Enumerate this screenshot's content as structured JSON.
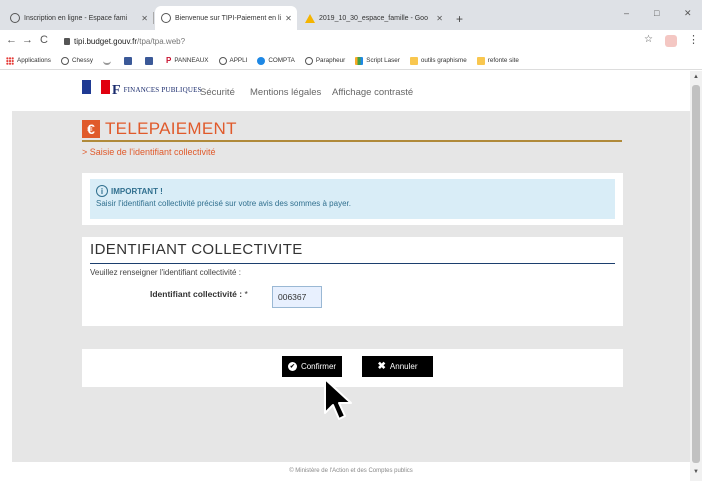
{
  "browser": {
    "tabs": [
      {
        "label": "Inscription en ligne - Espace fami"
      },
      {
        "label": "Bienvenue sur TIPI-Paiement en li"
      },
      {
        "label": "2019_10_30_espace_famille - Goo"
      }
    ],
    "new_tab": "+",
    "window_controls": {
      "minimize": "–",
      "maximize": "□",
      "close": "✕"
    },
    "nav": {
      "back": "←",
      "forward": "→",
      "reload": "C"
    },
    "url_domain": "tipi.budget.gouv.fr",
    "url_path": "/tpa/tpa.web?",
    "star": "☆",
    "menu": "⋮",
    "bookmarks": [
      {
        "label": "Applications"
      },
      {
        "label": "Chessy"
      },
      {
        "label": ""
      },
      {
        "label": ""
      },
      {
        "label": ""
      },
      {
        "label": "PANNEAUX"
      },
      {
        "label": "APPLI"
      },
      {
        "label": "COMPTA"
      },
      {
        "label": "Parapheur"
      },
      {
        "label": "Script Laser"
      },
      {
        "label": "outils graphisme"
      },
      {
        "label": "refonte site"
      }
    ]
  },
  "header": {
    "brand_mark": "F",
    "brand_line1": "FINANCES PUBLIQUES",
    "links": [
      {
        "label": "Sécurité"
      },
      {
        "label": "Mentions légales"
      },
      {
        "label": "Affichage contrasté"
      }
    ]
  },
  "telepaiement": {
    "euro": "€",
    "title": "TELEPAIEMENT",
    "breadcrumb": "> Saisie de l'identifiant collectivité"
  },
  "important": {
    "icon": "i",
    "heading": "IMPORTANT !",
    "body": "Saisir l'identifiant collectivité précisé sur votre avis des sommes à payer."
  },
  "identifiant": {
    "title": "IDENTIFIANT COLLECTIVITE",
    "description": "Veuillez renseigner l'identifiant collectivité :",
    "field_label": "Identifiant collectivité :",
    "required_mark": "*",
    "value": "006367"
  },
  "actions": {
    "confirm": "Confirmer",
    "cancel": "Annuler",
    "confirm_icon": "✔",
    "cancel_icon": "✖"
  },
  "footer": {
    "text": "© Ministère de l'Action et des Comptes publics"
  },
  "colors": {
    "accent": "#e05a2b",
    "alert_bg": "#d9edf7",
    "alert_text": "#31708f",
    "button_bg": "#000000",
    "page_bg": "#e6e6e6"
  }
}
